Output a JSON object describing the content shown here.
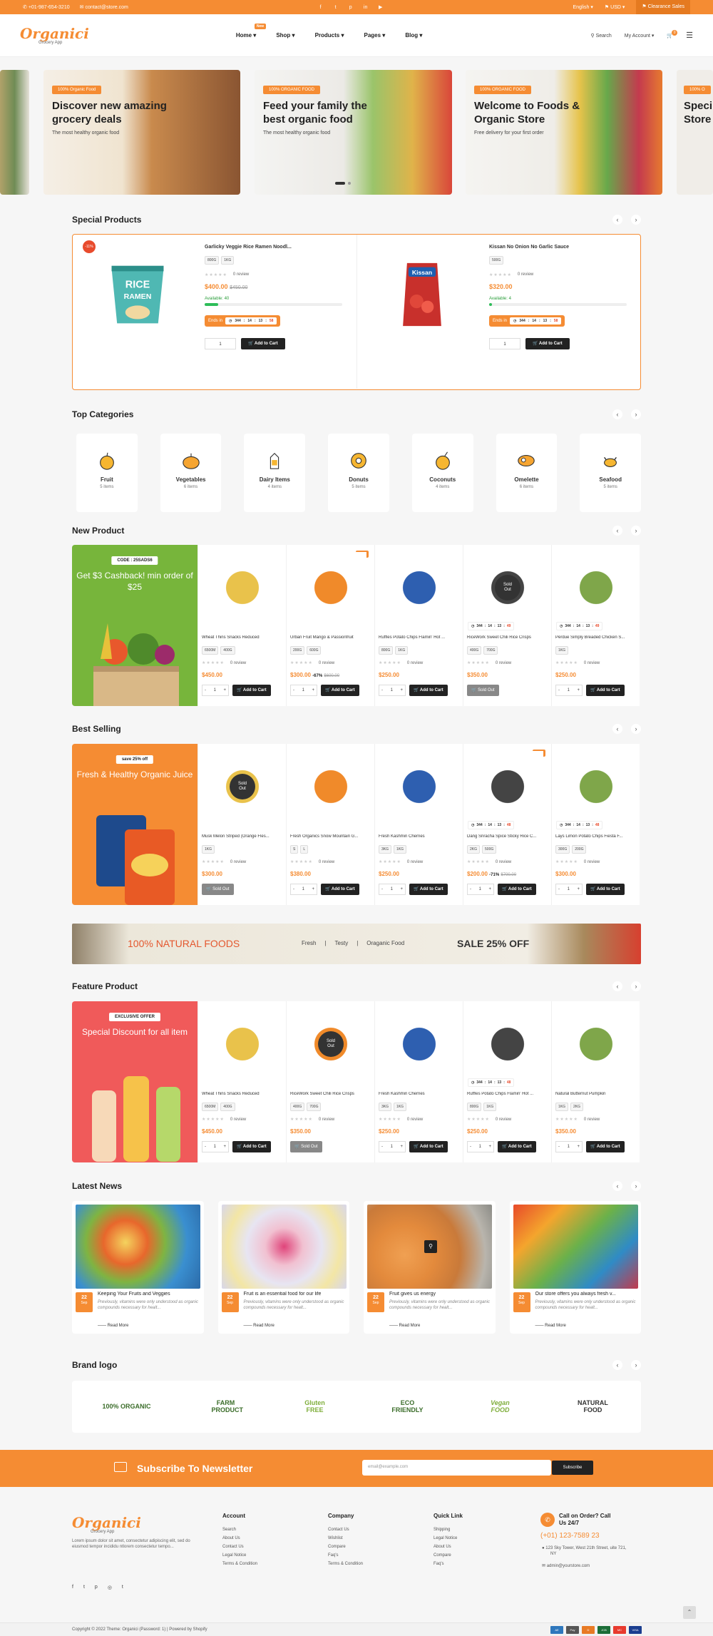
{
  "topbar": {
    "phone": "+01-987-654-3210",
    "email": "contact@store.com",
    "language": "English",
    "currency": "USD",
    "clearance": "Clearance Sales"
  },
  "header": {
    "logo": "Organici",
    "logo_sub": "Grocery App",
    "new_badge": "New",
    "nav": [
      "Home",
      "Shop",
      "Products",
      "Pages",
      "Blog"
    ],
    "search": "Search",
    "account": "My Account",
    "cart_count": "0"
  },
  "slides": [
    {
      "tag": "100% Organic Food",
      "title": "Discover new amazing grocery deals",
      "sub": "The most healthy organic food"
    },
    {
      "tag": "100% ORGANIC FOOD",
      "title": "Feed your family the best organic food",
      "sub": "The most healthy organic food"
    },
    {
      "tag": "100% ORGANIC FOOD",
      "title": "Welcome to Foods & Organic Store",
      "sub": "Free delivery for your first order"
    },
    {
      "tag": "100% O",
      "title": "Speci Store",
      "sub": ""
    }
  ],
  "special": {
    "title": "Special Products",
    "items": [
      {
        "discount": "-11%",
        "name": "Garlicky Veggie Rice Ramen Noodl...",
        "chips": [
          "800G",
          "1KG"
        ],
        "reviews": "0 review",
        "price": "$400.00",
        "old": "$450.00",
        "available": "Available: 40",
        "avail_fill": 0.1,
        "ends": "Ends in",
        "timer": [
          "344",
          "14",
          "13",
          "58"
        ],
        "qty": "1",
        "add": "Add to Cart"
      },
      {
        "discount": "",
        "name": "Kissan No Onion No Garlic Sauce",
        "chips": [
          "500G"
        ],
        "reviews": "0 review",
        "price": "$320.00",
        "old": "",
        "available": "Available: 4",
        "avail_fill": 0.01,
        "ends": "Ends in",
        "timer": [
          "344",
          "14",
          "13",
          "58"
        ],
        "qty": "1",
        "add": "Add to Cart"
      }
    ]
  },
  "categories": {
    "title": "Top Categories",
    "items": [
      {
        "name": "Fruit",
        "count": "5 items"
      },
      {
        "name": "Vegetables",
        "count": "6 items"
      },
      {
        "name": "Dairy Items",
        "count": "4 items"
      },
      {
        "name": "Donuts",
        "count": "5 items"
      },
      {
        "name": "Coconuts",
        "count": "4 items"
      },
      {
        "name": "Omelette",
        "count": "6 items"
      },
      {
        "name": "Seafood",
        "count": "5 items"
      }
    ]
  },
  "new_product": {
    "title": "New Product",
    "banner_tag": "CODE : 25SADS6",
    "banner_text": "Get $3 Cashback! min order of $25",
    "items": [
      {
        "name": "Wheat Thins Snacks Reduced",
        "chips": [
          "6500M",
          "400G"
        ],
        "reviews": "0 review",
        "price": "$450.00",
        "extra": "",
        "old": "",
        "sold": false,
        "sale": false,
        "timer": null,
        "qty": "1",
        "add": "Add to Cart"
      },
      {
        "name": "Urban Fruit Mango & Passionfruit",
        "chips": [
          "200G",
          "600G"
        ],
        "reviews": "0 review",
        "price": "$300.00",
        "extra": "-67%",
        "old": "$600.00",
        "sold": false,
        "sale": true,
        "timer": null,
        "qty": "1",
        "add": "Add to Cart"
      },
      {
        "name": "Ruffles Potato Chips Flamin' Hot ...",
        "chips": [
          "800G",
          "1KG"
        ],
        "reviews": "0 review",
        "price": "$250.00",
        "extra": "",
        "old": "",
        "sold": false,
        "sale": false,
        "timer": null,
        "qty": "1",
        "add": "Add to Cart"
      },
      {
        "name": "RiceWork Sweet Chili Rice Crisps",
        "chips": [
          "400G",
          "700G"
        ],
        "reviews": "0 review",
        "price": "$350.00",
        "extra": "",
        "old": "",
        "sold": true,
        "sale": false,
        "timer": [
          "344",
          "14",
          "13",
          "49"
        ],
        "qty": "",
        "add": "Sold Out"
      },
      {
        "name": "Perdue Simply Breaded Chicken S...",
        "chips": [
          "1KG"
        ],
        "reviews": "0 review",
        "price": "$250.00",
        "extra": "",
        "old": "",
        "sold": false,
        "sale": false,
        "timer": [
          "344",
          "14",
          "13",
          "49"
        ],
        "qty": "1",
        "add": "Add to Cart"
      }
    ]
  },
  "best_selling": {
    "title": "Best Selling",
    "banner_tag": "save 25% off",
    "banner_text": "Fresh & Healthy Organic Juice",
    "items": [
      {
        "name": "Musk Melon Striped (Orange Fles...",
        "chips": [
          "1KG"
        ],
        "reviews": "0 review",
        "price": "$300.00",
        "extra": "",
        "old": "",
        "sold": true,
        "sale": false,
        "timer": null,
        "qty": "",
        "add": "Sold Out"
      },
      {
        "name": "Fresh Organics Snow Mountain G...",
        "chips": [
          "S",
          "L"
        ],
        "reviews": "0 review",
        "price": "$380.00",
        "extra": "",
        "old": "",
        "sold": false,
        "sale": false,
        "timer": null,
        "qty": "1",
        "add": "Add to Cart"
      },
      {
        "name": "Fresh Kashmiri Cherries",
        "chips": [
          "3KG",
          "1KG"
        ],
        "reviews": "0 review",
        "price": "$250.00",
        "extra": "",
        "old": "",
        "sold": false,
        "sale": false,
        "timer": null,
        "qty": "1",
        "add": "Add to Cart"
      },
      {
        "name": "Dang Sriracha Spice Sticky Rice C...",
        "chips": [
          "2KG",
          "500G"
        ],
        "reviews": "0 review",
        "price": "$200.00",
        "extra": "-71%",
        "old": "$700.00",
        "sold": false,
        "sale": true,
        "timer": [
          "344",
          "14",
          "13",
          "48"
        ],
        "qty": "1",
        "add": "Add to Cart"
      },
      {
        "name": "Lays Limon Potato Chips Fiesta F...",
        "chips": [
          "300G",
          "200G"
        ],
        "reviews": "0 review",
        "price": "$300.00",
        "extra": "",
        "old": "",
        "sold": false,
        "sale": false,
        "timer": [
          "344",
          "14",
          "13",
          "48"
        ],
        "qty": "1",
        "add": "Add to Cart"
      }
    ]
  },
  "natural_banner": {
    "left": "100% NATURAL FOODS",
    "mid": [
      "Fresh",
      "Testy",
      "Oraganic Food"
    ],
    "right": "SALE 25% OFF"
  },
  "feature_product": {
    "title": "Feature Product",
    "banner_tag": "EXCLUSIVE OFFER",
    "banner_text": "Special Discount for all item",
    "items": [
      {
        "name": "Wheat Thins Snacks Reduced",
        "chips": [
          "6500M",
          "400G"
        ],
        "reviews": "0 review",
        "price": "$450.00",
        "extra": "",
        "old": "",
        "sold": false,
        "sale": false,
        "timer": null,
        "qty": "1",
        "add": "Add to Cart"
      },
      {
        "name": "RiceWork Sweet Chili Rice Crisps",
        "chips": [
          "400G",
          "700G"
        ],
        "reviews": "0 review",
        "price": "$350.00",
        "extra": "",
        "old": "",
        "sold": true,
        "sale": false,
        "timer": null,
        "qty": "",
        "add": "Sold Out"
      },
      {
        "name": "Fresh Kashmiri Cherries",
        "chips": [
          "3KG",
          "1KG"
        ],
        "reviews": "0 review",
        "price": "$250.00",
        "extra": "",
        "old": "",
        "sold": false,
        "sale": false,
        "timer": null,
        "qty": "1",
        "add": "Add to Cart"
      },
      {
        "name": "Ruffles Potato Chips Flamin' Hot ...",
        "chips": [
          "800G",
          "1KG"
        ],
        "reviews": "0 review",
        "price": "$250.00",
        "extra": "",
        "old": "",
        "sold": false,
        "sale": false,
        "timer": [
          "344",
          "14",
          "13",
          "48"
        ],
        "qty": "1",
        "add": "Add to Cart"
      },
      {
        "name": "Natural Butternut Pumpkin",
        "chips": [
          "1KG",
          "2KG"
        ],
        "reviews": "0 review",
        "price": "$350.00",
        "extra": "",
        "old": "",
        "sold": false,
        "sale": false,
        "timer": null,
        "qty": "1",
        "add": "Add to Cart"
      }
    ]
  },
  "news": {
    "title": "Latest News",
    "items": [
      {
        "day": "22",
        "mon": "Sep",
        "title": "Keeping Your Fruits and Veggies",
        "desc": "Previously, vitamins were only understood as organic compounds necessary for healt...",
        "more": "Read More"
      },
      {
        "day": "22",
        "mon": "Sep",
        "title": "Fruit is an essential food for our life",
        "desc": "Previously, vitamins were only understood as organic compounds necessary for healt...",
        "more": "Read More"
      },
      {
        "day": "22",
        "mon": "Sep",
        "title": "Fruit gives us energy",
        "desc": "Previously, vitamins were only understood as organic compounds necessary for healt...",
        "more": "Read More"
      },
      {
        "day": "22",
        "mon": "Sep",
        "title": "Our store offers you always fresh v...",
        "desc": "Previously, vitamins were only understood as organic compounds necessary for healt...",
        "more": "Read More"
      }
    ]
  },
  "brands": {
    "title": "Brand logo",
    "items": [
      "100% ORGANIC",
      "FARM PRODUCT",
      "Gluten FREE",
      "ECO FRIENDLY",
      "Vegan FOOD",
      "NATURAL FOOD"
    ]
  },
  "newsletter": {
    "title": "Subscribe To Newsletter",
    "placeholder": "email@example.com",
    "button": "Subscribe"
  },
  "footer": {
    "about": "Lorem ipsum dolor sit amet, consectetur adipiscing elit, sed do eiusmod tempor incididu ntlorem consectetur tempo...",
    "cols": [
      {
        "title": "Account",
        "links": [
          "Search",
          "About Us",
          "Contact Us",
          "Legal Notice",
          "Terms & Condition"
        ]
      },
      {
        "title": "Company",
        "links": [
          "Contact Us",
          "Wishlist",
          "Compare",
          "Faq's",
          "Terms & Condition"
        ]
      },
      {
        "title": "Quick Link",
        "links": [
          "Shipping",
          "Legal Notice",
          "About Us",
          "Compare",
          "Faq's"
        ]
      }
    ],
    "call_title": "Call on Order? Call Us 24/7",
    "phone": "(+01) 123-7589 23",
    "address": "123 Sky Tower, West 21th Street, uite 721, NY",
    "email": "admin@yourstore.com",
    "copyright": "Copyright © 2022 Theme: Organici (Password: 1) | Powered by Shopify"
  }
}
